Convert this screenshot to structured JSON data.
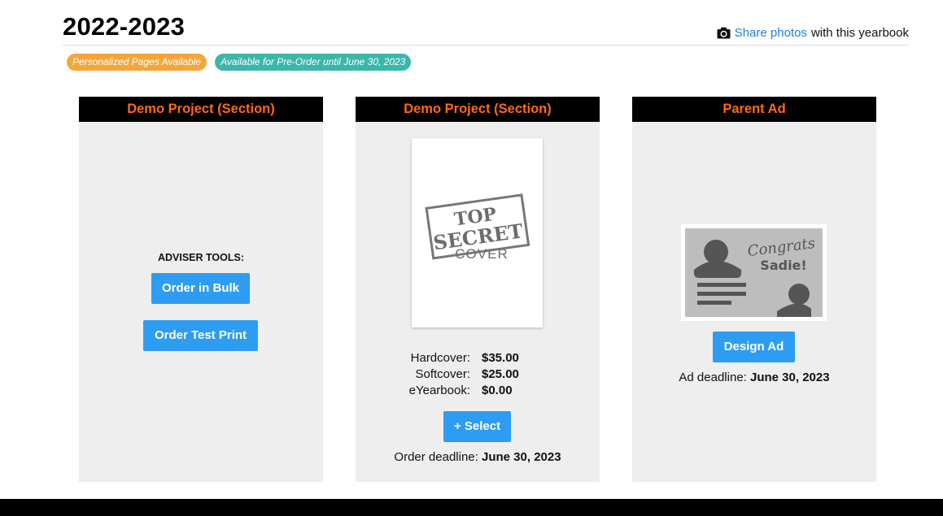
{
  "page": {
    "title": "2022-2023"
  },
  "share": {
    "link_text": "Share photos",
    "suffix_text": "with this yearbook",
    "icon": "camera-icon"
  },
  "badges": [
    {
      "label": "Personalized Pages Available",
      "color": "#f4a63a"
    },
    {
      "label": "Available for Pre-Order until June 30, 2023",
      "color": "#3bb7aa"
    }
  ],
  "colors": {
    "header_text": "#ff6a13",
    "button": "#2d9cf3",
    "link": "#1f7fd6"
  },
  "cards": [
    {
      "header": "Demo Project (Section)",
      "adviser_label": "ADVISER TOOLS:",
      "buttons": [
        "Order in Bulk",
        "Order Test Print"
      ]
    },
    {
      "header": "Demo Project (Section)",
      "cover_stamp": {
        "line1": "TOP",
        "line2": "SECRET",
        "line3": "COVER"
      },
      "prices": [
        {
          "label": "Hardcover:",
          "value": "$35.00"
        },
        {
          "label": "Softcover:",
          "value": "$25.00"
        },
        {
          "label": "eYearbook:",
          "value": "$0.00"
        }
      ],
      "select_button": "+ Select",
      "deadline_label": "Order deadline:",
      "deadline_value": "June 30, 2023"
    },
    {
      "header": "Parent Ad",
      "ad_text": {
        "line1": "Congrats",
        "line2": "Sadie!"
      },
      "button": "Design Ad",
      "deadline_label": "Ad deadline:",
      "deadline_value": "June 30, 2023"
    }
  ]
}
